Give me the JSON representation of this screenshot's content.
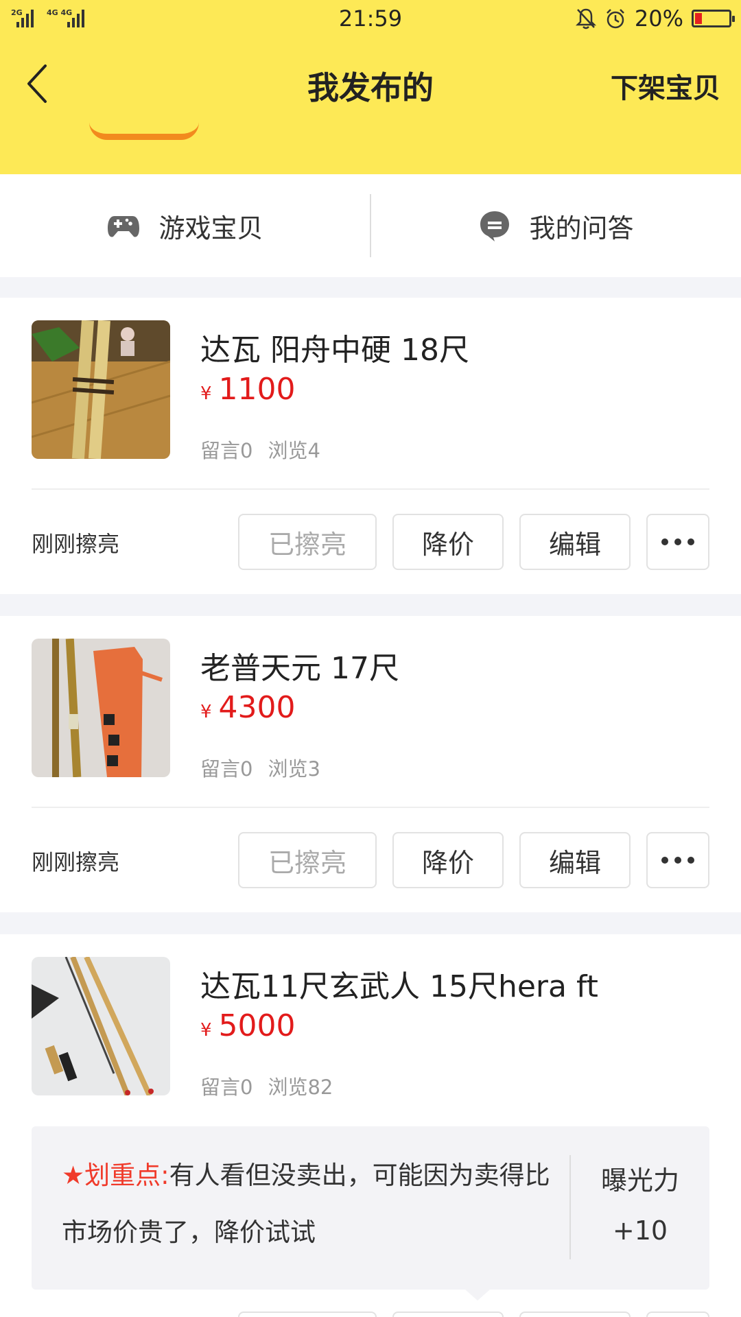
{
  "status_bar": {
    "signal_1_label": "2G",
    "signal_2_label": "4G 4G",
    "time": "21:59",
    "battery_percent": "20%",
    "battery_level": 0.2,
    "icons": [
      "mute-bell-icon",
      "alarm-icon",
      "battery-icon"
    ]
  },
  "header": {
    "title": "我发布的",
    "back_icon": "back-chevron-icon",
    "action_label": "下架宝贝"
  },
  "tabs": [
    {
      "icon": "gamepad-icon",
      "label": "游戏宝贝"
    },
    {
      "icon": "chat-bubble-icon",
      "label": "我的问答"
    }
  ],
  "items": [
    {
      "title": "达瓦 阳舟中硬 18尺",
      "currency": "¥",
      "price": "1100",
      "comments": "留言0",
      "views": "浏览4",
      "polish_status": "刚刚擦亮",
      "buttons": {
        "polished": "已擦亮",
        "reduce_price": "降价",
        "edit": "编辑",
        "more": "more-dots-icon"
      }
    },
    {
      "title": "老普天元 17尺",
      "currency": "¥",
      "price": "4300",
      "comments": "留言0",
      "views": "浏览3",
      "polish_status": "刚刚擦亮",
      "buttons": {
        "polished": "已擦亮",
        "reduce_price": "降价",
        "edit": "编辑",
        "more": "more-dots-icon"
      }
    },
    {
      "title": "达瓦11尺玄武人 15尺hera ft",
      "currency": "¥",
      "price": "5000",
      "comments": "留言0",
      "views": "浏览82"
    }
  ],
  "tip": {
    "highlight": "★划重点:",
    "text": "有人看但没卖出，可能因为卖得比市场价贵了，降价试试",
    "side_label": "曝光力",
    "side_value": "+10"
  },
  "colors": {
    "header_yellow": "#fde956",
    "price_red": "#e21b1b",
    "tip_red": "#f03a2a",
    "page_bg": "#f3f4f8"
  }
}
